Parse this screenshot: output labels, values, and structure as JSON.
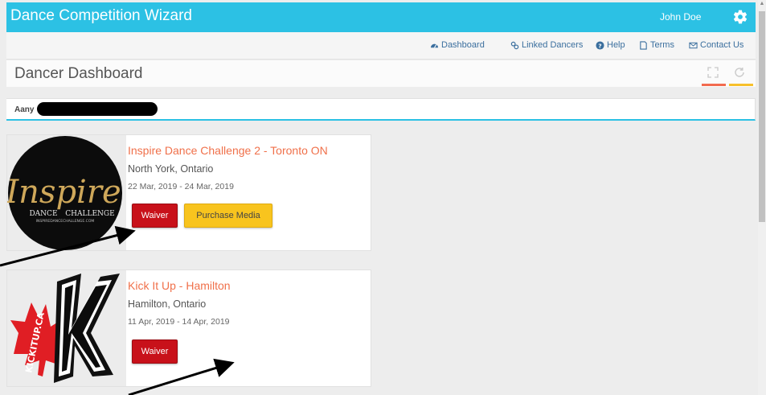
{
  "app": {
    "title": "Dance Competition Wizard",
    "user_name": "John Doe"
  },
  "nav": [
    {
      "label": "Dashboard",
      "icon": "dashboard-icon"
    },
    {
      "label": "Linked Dancers",
      "icon": "link-icon"
    },
    {
      "label": "Help",
      "icon": "help-icon"
    },
    {
      "label": "Terms",
      "icon": "document-icon"
    },
    {
      "label": "Contact Us",
      "icon": "envelope-icon"
    }
  ],
  "page": {
    "title": "Dancer Dashboard"
  },
  "dancer": {
    "name_visible": "Aany"
  },
  "events": [
    {
      "title": "Inspire Dance Challenge 2 - Toronto ON",
      "location": "North York, Ontario",
      "dates": "22 Mar, 2019 - 24 Mar, 2019",
      "waiver_label": "Waiver",
      "media_label": "Purchase Media",
      "logo": {
        "word": "Inspire",
        "sub1": "DANCE",
        "sub2": "CHALLENGE",
        "site": "INSPIREDANCECHALLENGE.COM"
      }
    },
    {
      "title": "Kick It Up - Hamilton",
      "location": "Hamilton, Ontario",
      "dates": "11 Apr, 2019 - 14 Apr, 2019",
      "waiver_label": "Waiver",
      "logo": {
        "word": "KICKITUP.CA",
        "letter": "K"
      }
    }
  ],
  "colors": {
    "accent": "#2cc1e4",
    "title_orange": "#f0704a",
    "waiver_red": "#c8111a",
    "media_yellow": "#f8c41e",
    "link_blue": "#3b6f9e"
  }
}
